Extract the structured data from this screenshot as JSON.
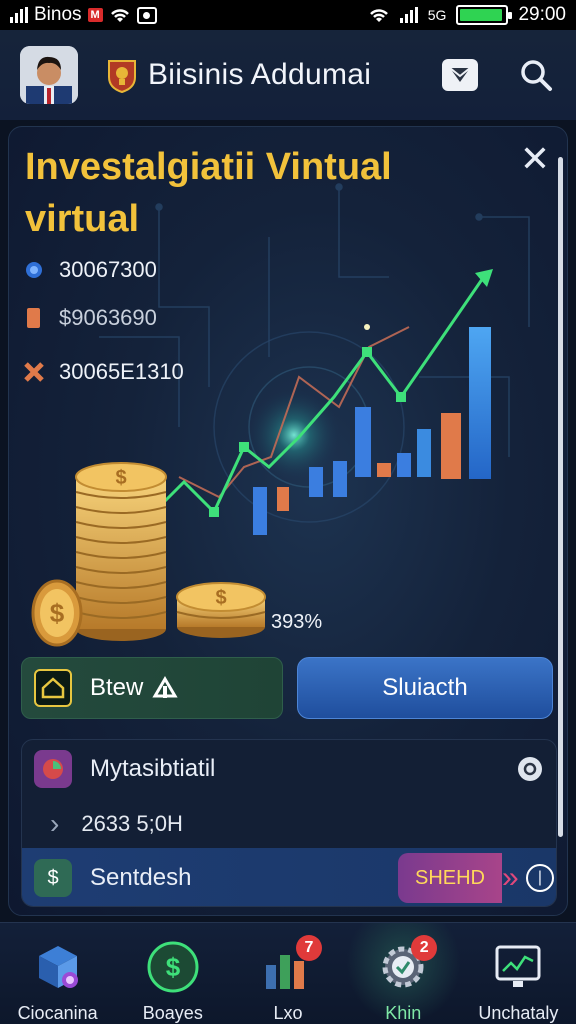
{
  "status_bar": {
    "carrier": "Binos",
    "time": "29:00",
    "battery_level": 0.95
  },
  "header": {
    "title": "Biisinis Addumai"
  },
  "card": {
    "title": "Investalgiatii Vintual virtual",
    "stats": [
      {
        "icon": "blue-dot-icon",
        "value": "30067300"
      },
      {
        "icon": "orange-bar-icon",
        "value": "$9063690"
      },
      {
        "icon": "orange-x-icon",
        "value": "30065E1310"
      }
    ],
    "chart_percent": "393%"
  },
  "buttons": {
    "left_label": "Btew",
    "right_label": "Sluiacth"
  },
  "list": {
    "item1_label": "Mytasibtiatil",
    "item2_value": "2633 5;0H",
    "item3_label": "Sentdesh",
    "item3_chip": "SHEHD"
  },
  "bottom_nav": [
    {
      "label": "Ciocanina",
      "icon": "cube-icon"
    },
    {
      "label": "Boayes",
      "icon": "dollar-coin-icon"
    },
    {
      "label": "Lxo",
      "icon": "bar-chart-icon",
      "badge": "7"
    },
    {
      "label": "Khin",
      "icon": "gear-check-icon",
      "badge": "2"
    },
    {
      "label": "Unchataly",
      "icon": "monitor-chart-icon"
    }
  ],
  "colors": {
    "accent_gold": "#f2c23b",
    "chart_green": "#3ee07a",
    "chart_blue": "#3b8be0",
    "chart_orange": "#e07a4a"
  }
}
